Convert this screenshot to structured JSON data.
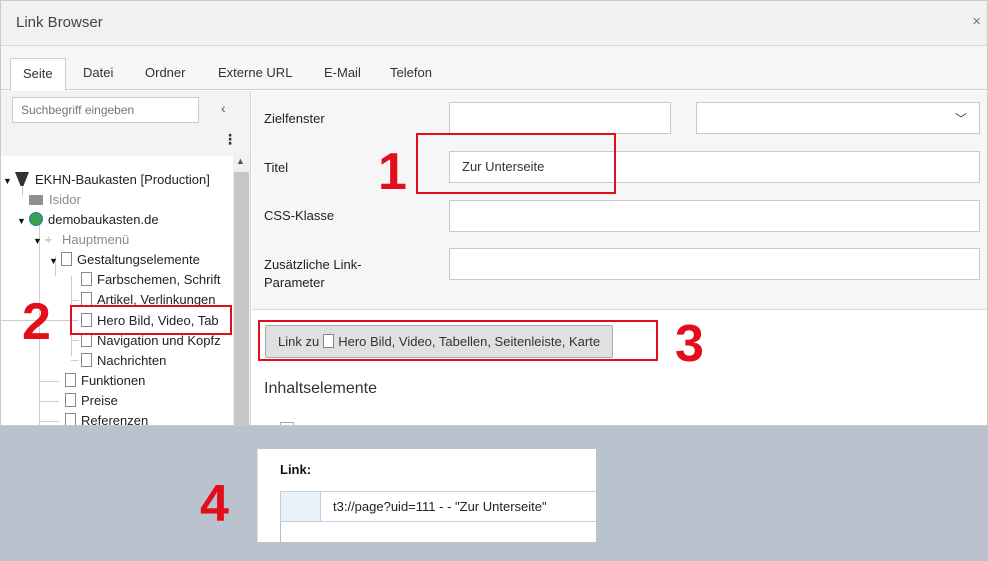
{
  "dialog": {
    "title": "Link Browser",
    "close_glyph": "×"
  },
  "tabs": [
    {
      "label": "Seite",
      "active": true
    },
    {
      "label": "Datei",
      "active": false
    },
    {
      "label": "Ordner",
      "active": false
    },
    {
      "label": "Externe URL",
      "active": false
    },
    {
      "label": "E-Mail",
      "active": false
    },
    {
      "label": "Telefon",
      "active": false
    }
  ],
  "sidebar": {
    "search_placeholder": "Suchbegriff eingeben",
    "collapse_glyph": "‹",
    "menu_glyph": "⋮",
    "tree": [
      {
        "label": "EKHN-Baukasten [Production]",
        "icon": "typo3-icon",
        "expanded": true
      },
      {
        "label": "Isidor",
        "icon": "folder-icon",
        "muted": true
      },
      {
        "label": "demobaukasten.de",
        "icon": "globe-icon",
        "expanded": true
      },
      {
        "label": "Hauptmenü",
        "icon": "separator-icon",
        "muted": true,
        "expanded": true
      },
      {
        "label": "Gestaltungselemente",
        "icon": "page-icon",
        "expanded": true
      },
      {
        "label": "Farbschemen, Schrift",
        "icon": "page-icon"
      },
      {
        "label": "Artikel, Verlinkungen",
        "icon": "page-icon"
      },
      {
        "label": "Hero Bild, Video, Tab",
        "icon": "page-icon",
        "selected": true
      },
      {
        "label": "Navigation und Kopfz",
        "icon": "page-icon"
      },
      {
        "label": "Nachrichten",
        "icon": "page-icon"
      },
      {
        "label": "Funktionen",
        "icon": "page-icon"
      },
      {
        "label": "Preise",
        "icon": "page-icon"
      },
      {
        "label": "Referenzen",
        "icon": "page-icon"
      }
    ]
  },
  "form": {
    "target_label": "Zielfenster",
    "target_value": "",
    "target_select_value": "",
    "title_label": "Titel",
    "title_value": "Zur Unterseite",
    "css_label": "CSS-Klasse",
    "css_value": "",
    "params_label": "Zusätzliche Link-Parameter",
    "params_value": ""
  },
  "link_button": {
    "prefix": "Link zu",
    "page": "Hero Bild, Video, Tabellen, Seitenleiste, Karte"
  },
  "content_section": {
    "heading": "Inhaltselemente"
  },
  "annotations": [
    "1",
    "2",
    "3",
    "4"
  ],
  "link_panel": {
    "heading": "Link:",
    "value": "t3://page?uid=111 - - \"Zur Unterseite\""
  },
  "colors": {
    "annotation_red": "#e30e1b",
    "backdrop": "#b9c2cd"
  }
}
